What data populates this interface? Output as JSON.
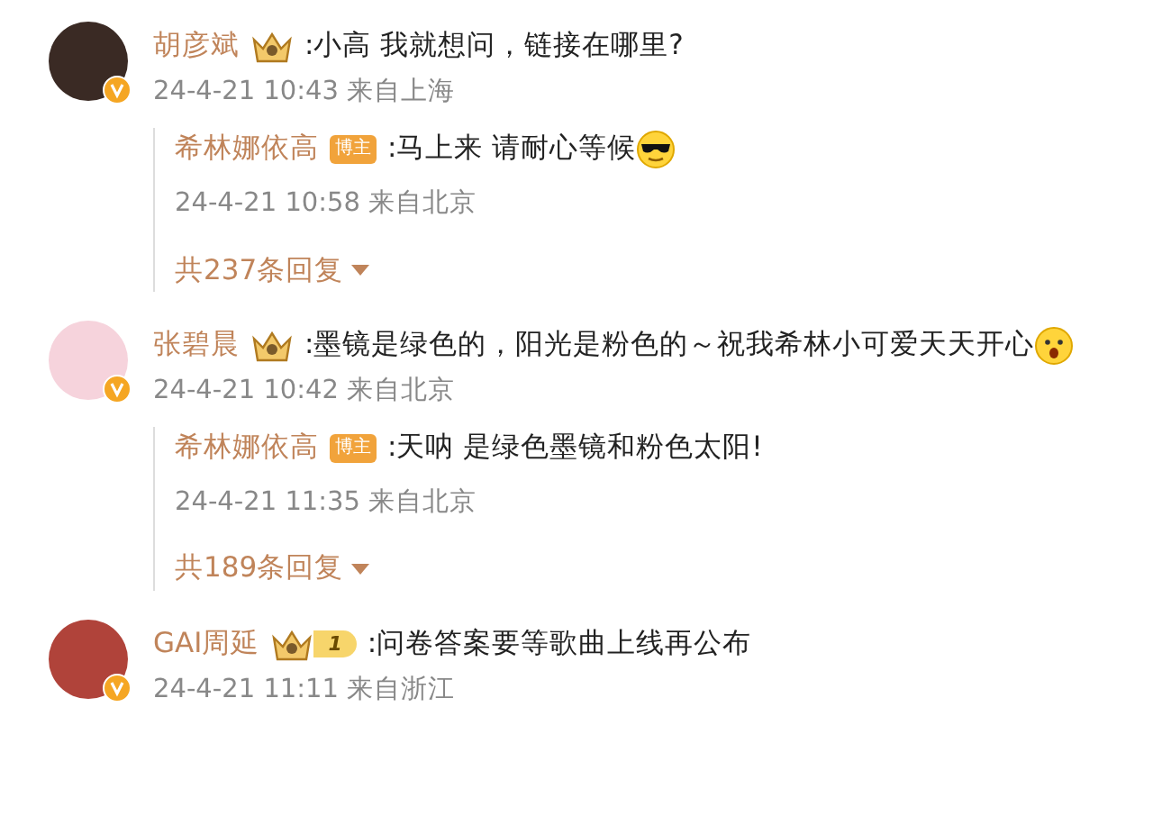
{
  "comments": [
    {
      "avatar": {
        "color": "#3a2a24"
      },
      "name": "胡彦斌",
      "badge": {
        "kind": "crown"
      },
      "text": ":小高 我就想问，链接在哪里?",
      "time": "24-4-21 10:43 来自上海",
      "replies": [
        {
          "name": "希林娜依高",
          "tag": "博主",
          "text": ":马上来 请耐心等候",
          "emoji": {
            "kind": "cool"
          },
          "time": "24-4-21 10:58 来自北京"
        }
      ],
      "more": "共237条回复"
    },
    {
      "avatar": {
        "color": "#f6d3dc"
      },
      "name": "张碧晨",
      "badge": {
        "kind": "crown"
      },
      "text": ":墨镜是绿色的，阳光是粉色的～祝我希林小可爱天天开心",
      "emoji": {
        "kind": "surprised"
      },
      "time": "24-4-21 10:42 来自北京",
      "replies": [
        {
          "name": "希林娜依高",
          "tag": "博主",
          "text": ":天呐 是绿色墨镜和粉色太阳!",
          "time": "24-4-21 11:35 来自北京"
        }
      ],
      "more": "共189条回复"
    },
    {
      "avatar": {
        "color": "#b0433a"
      },
      "name": "GAI周延",
      "badge": {
        "kind": "crown-level",
        "level": "1"
      },
      "text": ":问卷答案要等歌曲上线再公布",
      "time": "24-4-21 11:11 来自浙江"
    }
  ]
}
